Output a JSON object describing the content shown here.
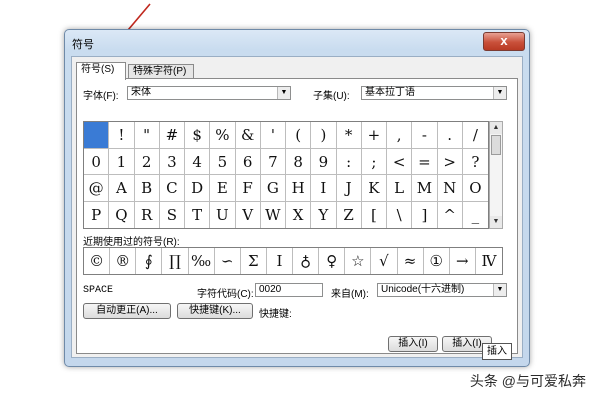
{
  "window": {
    "title": "符号",
    "close_glyph": "x"
  },
  "tabs": [
    {
      "label": "符号(S)",
      "active": true
    },
    {
      "label": "特殊字符(P)",
      "active": false
    }
  ],
  "font": {
    "label": "字体(F):",
    "value": "宋体"
  },
  "subset": {
    "label": "子集(U):",
    "value": "基本拉丁语"
  },
  "symbol_grid": {
    "rows": [
      [
        " ",
        "!",
        "\"",
        "#",
        "$",
        "%",
        "&",
        "'",
        "(",
        ")",
        "*",
        "+",
        ",",
        "-",
        ".",
        "/"
      ],
      [
        "0",
        "1",
        "2",
        "3",
        "4",
        "5",
        "6",
        "7",
        "8",
        "9",
        ":",
        ";",
        "<",
        "=",
        ">",
        "?"
      ],
      [
        "@",
        "A",
        "B",
        "C",
        "D",
        "E",
        "F",
        "G",
        "H",
        "I",
        "J",
        "K",
        "L",
        "M",
        "N",
        "O"
      ],
      [
        "P",
        "Q",
        "R",
        "S",
        "T",
        "U",
        "V",
        "W",
        "X",
        "Y",
        "Z",
        "[",
        "\\",
        "]",
        "^",
        "_"
      ]
    ],
    "selected_index": 0
  },
  "recent": {
    "label": "近期使用过的符号(R):",
    "symbols": [
      "©",
      "®",
      "∮",
      "∏",
      "‰",
      "∽",
      "Σ",
      "Ⅰ",
      "♁",
      "♀",
      "☆",
      "√",
      "≈",
      "①",
      "→",
      "Ⅳ"
    ]
  },
  "char_name": "SPACE",
  "char_code": {
    "label": "字符代码(C):",
    "value": "0020"
  },
  "from": {
    "label": "来自(M):",
    "value": "Unicode(十六进制)"
  },
  "buttons": {
    "autocorrect": "自动更正(A)...",
    "shortcut_key": "快捷键(K)...",
    "shortcut_label": "快捷键:",
    "insert_1": "插入(I)",
    "insert_2": "插入(I)"
  },
  "tooltip": "插入",
  "watermark": "头条 @与可爱私奔",
  "colors": {
    "arrow": "#c0281e",
    "selection": "#3a7bd5",
    "title_gradient_top": "#dbe8f6"
  }
}
